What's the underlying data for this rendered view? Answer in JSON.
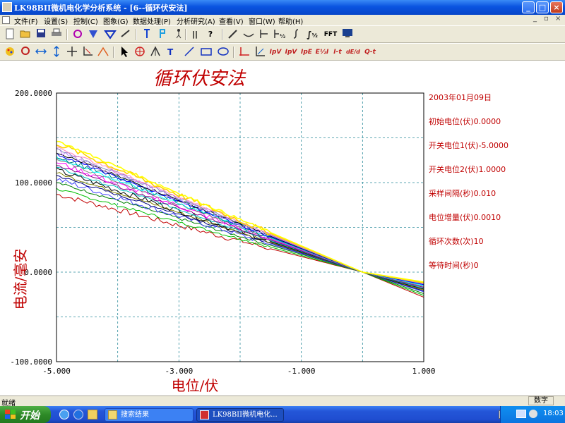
{
  "window": {
    "title": "LK98BII微机电化学分析系统 - [6--循环伏安法]",
    "min": "_",
    "max": "□",
    "close": "×",
    "doc_min": "_",
    "doc_restore": "▫",
    "doc_close": "×"
  },
  "menu": [
    "文件(F)",
    "设置(S)",
    "控制(C)",
    "图象(G)",
    "数据处理(P)",
    "分析研究(A)",
    "查看(V)",
    "窗口(W)",
    "帮助(H)"
  ],
  "toolbar1": {
    "pause": "||",
    "help": "?",
    "fft": "FFT",
    "half": "½"
  },
  "toolbar2": {
    "t1": "IpV",
    "t2": "IpV",
    "t3": "IpE",
    "t4": "E½I",
    "t5": "I-t",
    "t6": "dE/dt",
    "t7": "Q-t"
  },
  "chart_data": {
    "type": "line",
    "title": "循环伏安法",
    "xlabel": "电位/伏",
    "ylabel": "电流/毫安",
    "xlim": [
      -5.0,
      1.0
    ],
    "ylim": [
      -100.0,
      200.0
    ],
    "x_ticks": [
      "-5.000",
      "-3.000",
      "-1.000",
      "1.000"
    ],
    "y_ticks": [
      "200.0000",
      "100.0000",
      "0.0000",
      "-100.0000"
    ],
    "grid": true,
    "intersection": {
      "x": 0.0,
      "y": 0.0
    },
    "series": [
      {
        "color": "#c00000",
        "start": 87,
        "end": -28
      },
      {
        "color": "#00c000",
        "start": 93,
        "end": -26
      },
      {
        "color": "#008000",
        "start": 100,
        "end": -24
      },
      {
        "color": "#4040ff",
        "start": 104,
        "end": -22
      },
      {
        "color": "#000080",
        "start": 108,
        "end": -21
      },
      {
        "color": "#808000",
        "start": 111,
        "end": -20
      },
      {
        "color": "#000000",
        "start": 114,
        "end": -19
      },
      {
        "color": "#00c0c0",
        "start": 117,
        "end": -18
      },
      {
        "color": "#800080",
        "start": 120,
        "end": -17
      },
      {
        "color": "#ff00ff",
        "start": 123,
        "end": -16
      },
      {
        "color": "#808080",
        "start": 126,
        "end": -16
      },
      {
        "color": "#00ffff",
        "start": 128,
        "end": -15
      },
      {
        "color": "#008080",
        "start": 130,
        "end": -14
      },
      {
        "color": "#0000ff",
        "start": 132,
        "end": -14
      },
      {
        "color": "#000000",
        "start": 134,
        "end": -13
      },
      {
        "color": "#c080ff",
        "start": 136,
        "end": -13
      },
      {
        "color": "#8080c0",
        "start": 138,
        "end": -12
      },
      {
        "color": "#ff80c0",
        "start": 140,
        "end": -12
      },
      {
        "color": "#ffd000",
        "start": 144,
        "end": -12
      },
      {
        "color": "#ffff00",
        "start": 147,
        "end": -11
      }
    ],
    "annotations": [
      "2003年01月09日",
      "初始电位(伏)0.0000",
      "开关电位1(伏)-5.0000",
      "开关电位2(伏)1.0000",
      "采样间隔(秒)0.010",
      "电位增量(伏)0.0010",
      "循环次数(次)10",
      "等待时间(秒)0"
    ]
  },
  "status": {
    "left": "就绪",
    "right": "数字"
  },
  "taskbar": {
    "start": "开始",
    "items": [
      "搜索结果",
      "LK98BII微机电化..."
    ],
    "time": "18:03"
  }
}
